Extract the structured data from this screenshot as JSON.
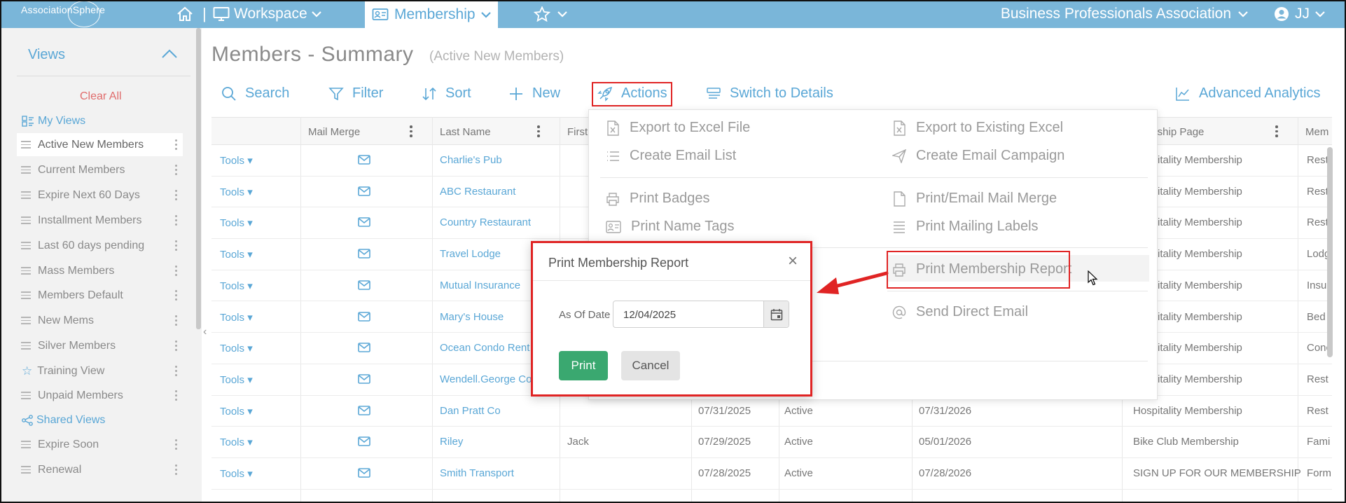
{
  "header": {
    "logo": "AssociationSphere",
    "separator": "|",
    "workspace": "Workspace",
    "membership": "Membership",
    "organization": "Business Professionals Association",
    "user": "JJ"
  },
  "sidebar": {
    "views_title": "Views",
    "clear_all": "Clear All",
    "my_views": "My Views",
    "items": [
      {
        "label": "Active New Members"
      },
      {
        "label": "Current Members"
      },
      {
        "label": "Expire Next 60 Days"
      },
      {
        "label": "Installment Members"
      },
      {
        "label": "Last 60 days pending"
      },
      {
        "label": "Mass Members"
      },
      {
        "label": "Members Default"
      },
      {
        "label": "New Mems"
      },
      {
        "label": "Silver Members"
      },
      {
        "label": "Training View"
      },
      {
        "label": "Unpaid Members"
      }
    ],
    "shared_views": "Shared Views",
    "shared_items": [
      {
        "label": "Expire Soon"
      },
      {
        "label": "Renewal"
      }
    ]
  },
  "page": {
    "title": "Members - Summary",
    "subtitle": "(Active New Members)"
  },
  "toolbar": {
    "search": "Search",
    "filter": "Filter",
    "sort": "Sort",
    "new": "New",
    "actions": "Actions",
    "switch": "Switch to Details",
    "analytics": "Advanced Analytics"
  },
  "table": {
    "headers": {
      "mail_merge": "Mail Merge",
      "last_name": "Last Name",
      "first": "First",
      "membership_page": "bership Page",
      "mem": "Mem"
    },
    "tools_label": "Tools",
    "rows": [
      {
        "last": "Charlie's Pub",
        "first": "",
        "joined": "",
        "status": "",
        "expires": "",
        "page": "Hospitality Membership",
        "type": "Rest"
      },
      {
        "last": "ABC Restaurant",
        "first": "",
        "joined": "",
        "status": "",
        "expires": "",
        "page": "Hospitality Membership",
        "type": "Rest"
      },
      {
        "last": "Country Restaurant",
        "first": "",
        "joined": "",
        "status": "",
        "expires": "",
        "page": "Hospitality Membership",
        "type": "Rest"
      },
      {
        "last": "Travel Lodge",
        "first": "",
        "joined": "",
        "status": "",
        "expires": "",
        "page": "Hospitality Membership",
        "type": "Lodg"
      },
      {
        "last": "Mutual Insurance",
        "first": "",
        "joined": "",
        "status": "",
        "expires": "",
        "page": "Hospitality Membership",
        "type": "Insu"
      },
      {
        "last": "Mary's House",
        "first": "",
        "joined": "",
        "status": "",
        "expires": "",
        "page": "Hospitality Membership",
        "type": "Bed"
      },
      {
        "last": "Ocean Condo Rent",
        "first": "",
        "joined": "",
        "status": "",
        "expires": "",
        "page": "Hospitality Membership",
        "type": "Conc"
      },
      {
        "last": "Wendell.George Co",
        "first": "",
        "joined": "",
        "status": "",
        "expires": "",
        "page": "Hospitality Membership",
        "type": "Rest"
      },
      {
        "last": "Dan Pratt Co",
        "first": "",
        "joined": "07/31/2025",
        "status": "Active",
        "expires": "07/31/2026",
        "page": "Hospitality Membership",
        "type": "Rest"
      },
      {
        "last": "Riley",
        "first": "Jack",
        "joined": "07/29/2025",
        "status": "Active",
        "expires": "05/01/2026",
        "page": "Bike Club Membership",
        "type": "Fami"
      },
      {
        "last": "Smith Transport",
        "first": "",
        "joined": "07/28/2025",
        "status": "Active",
        "expires": "07/28/2026",
        "page": "SIGN UP FOR OUR MEMBERSHIP",
        "type": "Form"
      }
    ]
  },
  "actions_menu": {
    "export_excel": "Export to Excel File",
    "export_existing": "Export to Existing Excel",
    "email_list": "Create Email List",
    "email_campaign": "Create Email Campaign",
    "print_badges": "Print Badges",
    "print_mail_merge": "Print/Email Mail Merge",
    "print_name_tags": "Print Name Tags",
    "print_mailing_labels": "Print Mailing Labels",
    "print_membership_report": "Print Membership Report",
    "send_direct_email": "Send Direct Email"
  },
  "modal": {
    "title": "Print Membership Report",
    "close": "×",
    "as_of_label": "As Of Date",
    "as_of_value": "12/04/2025",
    "print": "Print",
    "cancel": "Cancel"
  },
  "colors": {
    "topbar": "#7ab6d9",
    "accent": "#5aa7d6",
    "highlight_red": "#e02424",
    "print_green": "#3aa870",
    "clear_all_red": "#e06c6c"
  }
}
